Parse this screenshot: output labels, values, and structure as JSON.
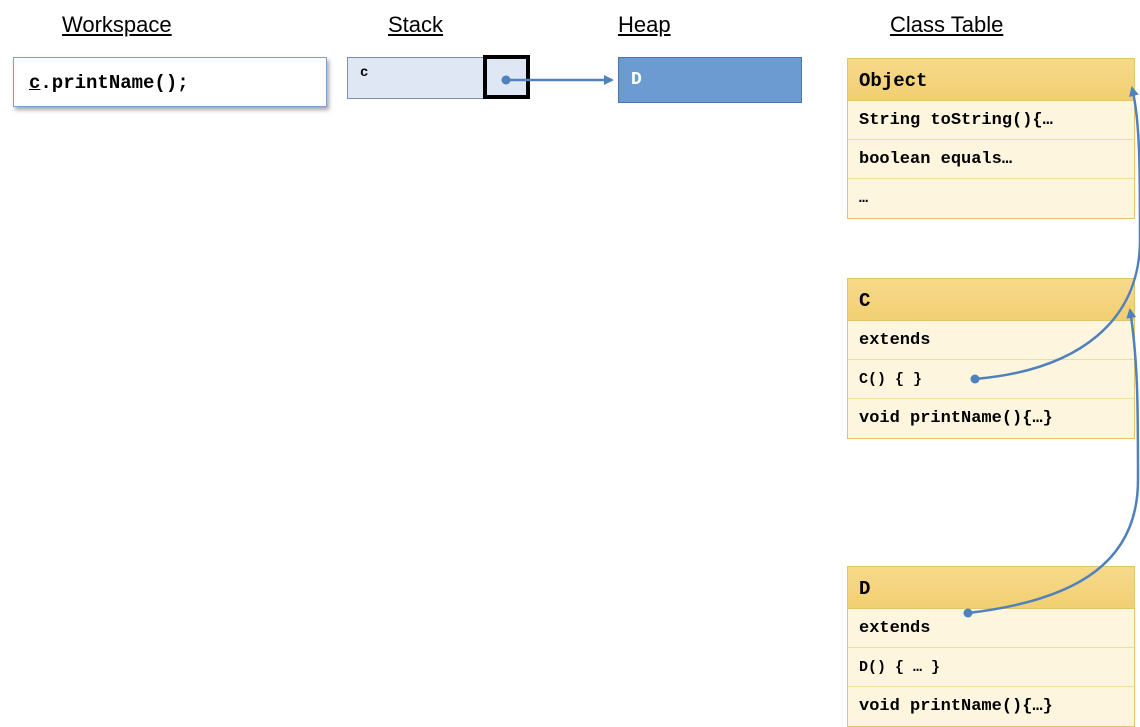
{
  "headers": {
    "workspace": "Workspace",
    "stack": "Stack",
    "heap": "Heap",
    "class_table": "Class Table"
  },
  "workspace": {
    "code_var": "c",
    "code_rest": ".printName();"
  },
  "stack": {
    "var_name": "c"
  },
  "heap": {
    "object_label": "D"
  },
  "class_table": {
    "object": {
      "title": "Object",
      "rows": [
        "String toString(){…",
        "boolean equals…",
        "…"
      ]
    },
    "c": {
      "title": "C",
      "rows": [
        "extends",
        "C() { }",
        "void printName(){…}"
      ]
    },
    "d": {
      "title": "D",
      "rows": [
        "extends",
        "D() { … }",
        "void printName(){…}"
      ]
    }
  },
  "colors": {
    "arrow": "#4f81bd",
    "heap_fill": "#6b9bd0",
    "stack_fill": "#dfe7f4",
    "class_title": "#f2cf72",
    "class_row": "#fdf5de"
  }
}
